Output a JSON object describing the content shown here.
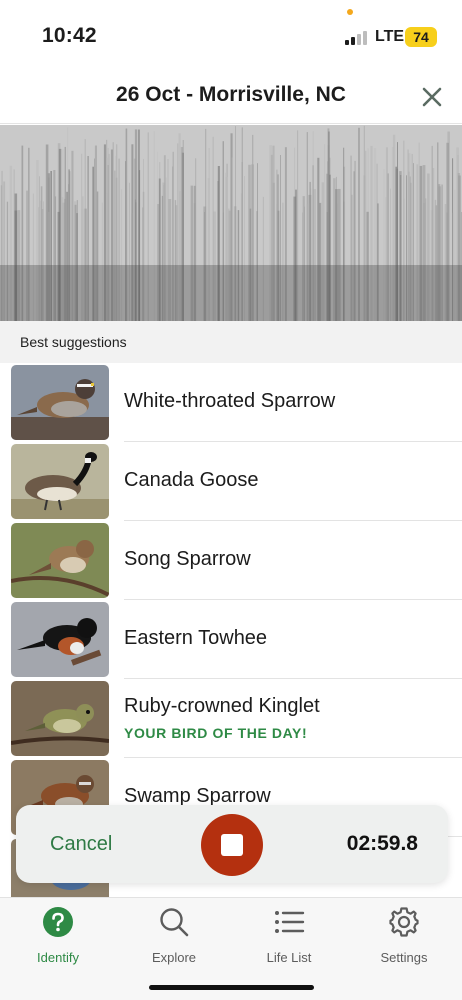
{
  "status_bar": {
    "time": "10:42",
    "network": "LTE",
    "battery": "74",
    "battery_color": "#f7cf1b"
  },
  "header": {
    "title": "26 Oct - Morrisville, NC",
    "close_icon": "close-icon"
  },
  "suggestions": {
    "section_title": "Best suggestions",
    "items": [
      {
        "name": "White-throated Sparrow",
        "subtitle": "",
        "thumb": "white-throated-sparrow-photo"
      },
      {
        "name": "Canada Goose",
        "subtitle": "",
        "thumb": "canada-goose-photo"
      },
      {
        "name": "Song Sparrow",
        "subtitle": "",
        "thumb": "song-sparrow-photo"
      },
      {
        "name": "Eastern Towhee",
        "subtitle": "",
        "thumb": "eastern-towhee-photo"
      },
      {
        "name": "Ruby-crowned Kinglet",
        "subtitle": "YOUR BIRD OF THE DAY!",
        "thumb": "ruby-crowned-kinglet-photo"
      },
      {
        "name": "Swamp Sparrow",
        "subtitle": "",
        "thumb": "swamp-sparrow-photo"
      }
    ]
  },
  "recording": {
    "cancel_label": "Cancel",
    "timer": "02:59.8",
    "stop_icon": "stop-icon",
    "stop_color": "#b4300f"
  },
  "tabs": [
    {
      "label": "Identify",
      "icon": "question-circle-icon",
      "active": true
    },
    {
      "label": "Explore",
      "icon": "search-icon",
      "active": false
    },
    {
      "label": "Life List",
      "icon": "list-icon",
      "active": false
    },
    {
      "label": "Settings",
      "icon": "gear-icon",
      "active": false
    }
  ],
  "colors": {
    "accent_green": "#2e8a45",
    "record_red": "#b4300f"
  }
}
